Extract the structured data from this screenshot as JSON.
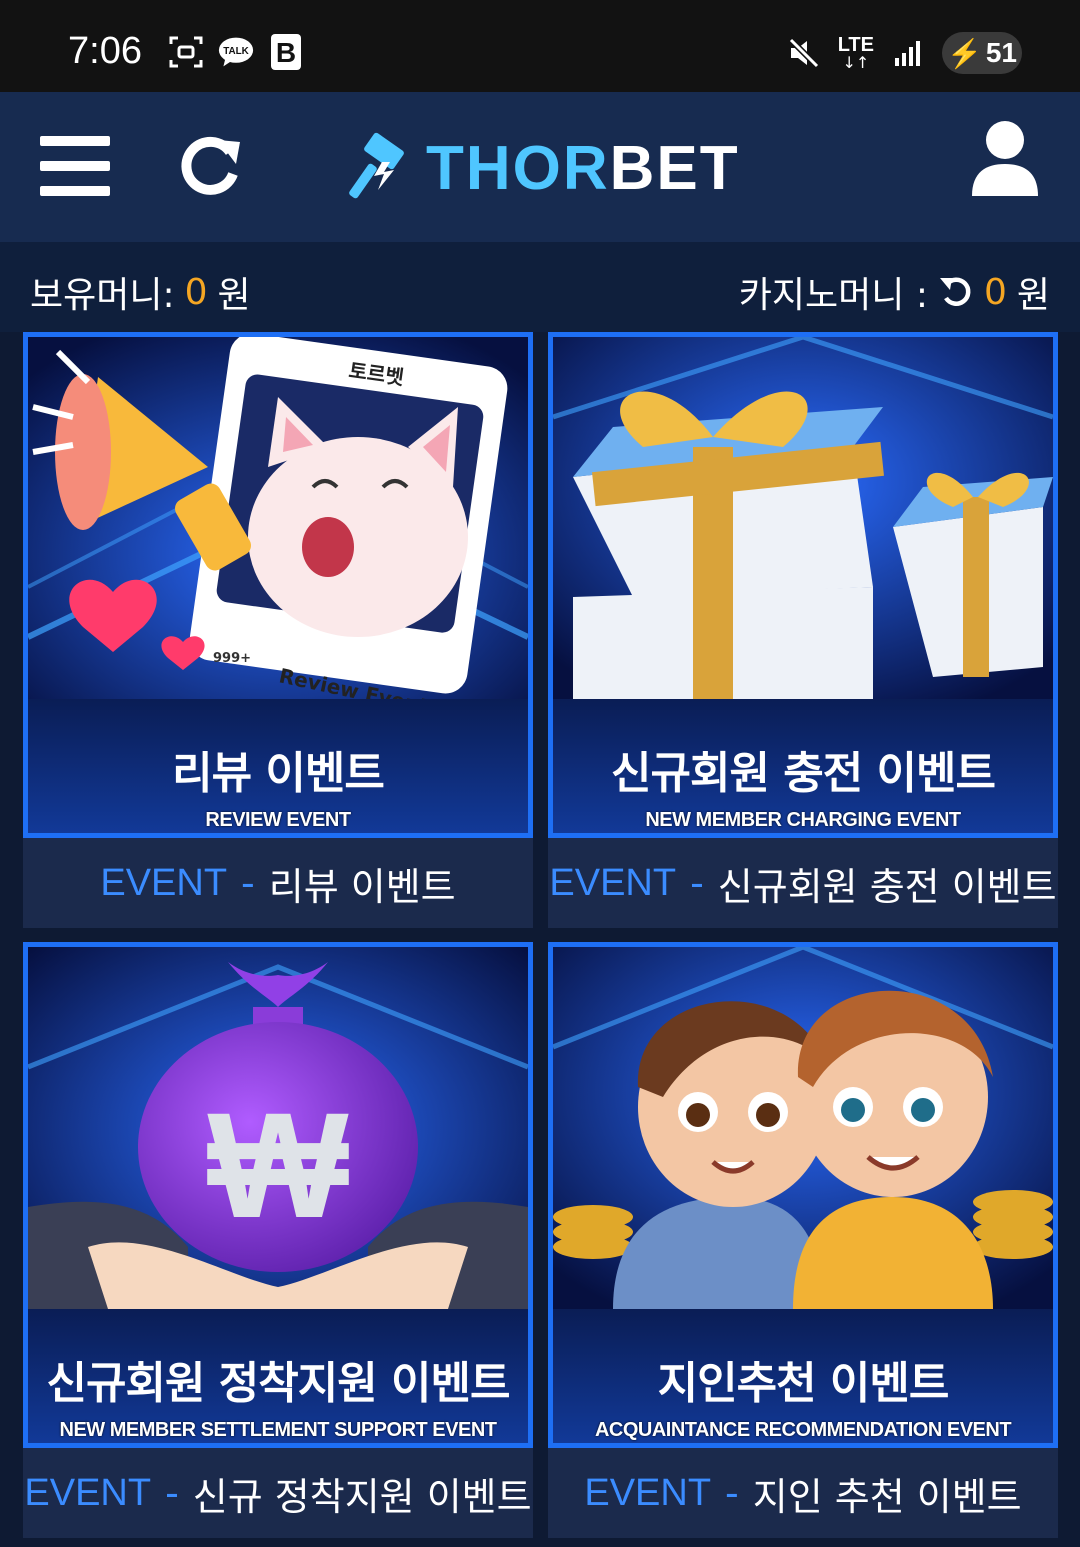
{
  "status_bar": {
    "time": "7:06",
    "talk_label": "TALK",
    "b_label": "B",
    "network": "LTE",
    "battery": "51"
  },
  "header": {
    "logo_part1": "THOR",
    "logo_part2": "BET",
    "menu_icon": "hamburger-icon",
    "refresh_icon": "refresh-icon",
    "user_icon": "user-icon"
  },
  "money": {
    "holding_label": "보유머니:",
    "holding_amount": "0",
    "holding_unit": "원",
    "casino_label": "카지노머니 :",
    "casino_amount": "0",
    "casino_unit": "원"
  },
  "colors": {
    "accent": "#1e6ff5",
    "amount": "#f5a623",
    "event_label": "#3b8cff",
    "logo": "#4fc6ff"
  },
  "events": [
    {
      "banner_ko": "리뷰 이벤트",
      "banner_en": "REVIEW EVENT",
      "prefix": "EVENT",
      "sep": "-",
      "name": "리뷰 이벤트",
      "art_texts": {
        "card_top": "토르벳",
        "likes": "999+",
        "bottom": "Review Event"
      },
      "art": "cat-megaphone"
    },
    {
      "banner_ko": "신규회원 충전 이벤트",
      "banner_en": "NEW MEMBER CHARGING EVENT",
      "prefix": "EVENT",
      "sep": "-",
      "name": "신규회원 충전 이벤트",
      "art": "gift-boxes"
    },
    {
      "banner_ko": "신규회원 정착지원 이벤트",
      "banner_en": "NEW MEMBER SETTLEMENT SUPPORT EVENT",
      "prefix": "EVENT",
      "sep": "-",
      "name": "신규 정착지원 이벤트",
      "art_texts": {
        "won_symbol": "₩"
      },
      "art": "money-bag"
    },
    {
      "banner_ko": "지인추천 이벤트",
      "banner_en": "ACQUAINTANCE RECOMMENDATION EVENT",
      "prefix": "EVENT",
      "sep": "-",
      "name": "지인 추천 이벤트",
      "art": "two-kids"
    }
  ]
}
